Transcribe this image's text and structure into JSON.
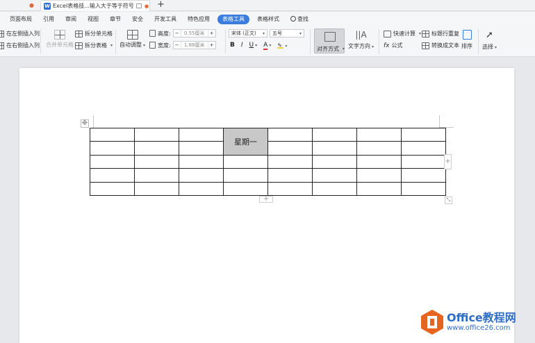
{
  "tabbar": {
    "doc_tab_title": "Excel表格技...输入大于等于符号",
    "doc_icon_letter": "W",
    "new_tab": "+"
  },
  "menu": {
    "items": [
      "页面布局",
      "引用",
      "审阅",
      "视图",
      "章节",
      "安全",
      "开发工具",
      "特色应用",
      "表格工具",
      "表格样式"
    ],
    "active_index": 8,
    "search_label": "查找"
  },
  "ribbon": {
    "insert_left": "在左侧插入列",
    "insert_right": "在右侧插入列",
    "merge_cells": "合并单元格",
    "split_cells": "拆分单元格",
    "split_table": "拆分表格",
    "auto_fit": "自动调整",
    "height_label": "高度:",
    "height_value": "0.55厘米",
    "width_label": "宽度:",
    "width_value": "1.88厘米",
    "font_name": "宋体 (正文)",
    "font_size": "五号",
    "bold": "B",
    "italic": "I",
    "underline": "U",
    "font_color": "A",
    "align": "对齐方式",
    "text_direction": "文字方向",
    "quick_calc": "快速计算",
    "formula": "公式",
    "formula_fx": "fx",
    "repeat_header": "标题行重复",
    "to_text": "转换成文本",
    "sort": "排序",
    "select": "选择"
  },
  "table": {
    "rows": 5,
    "cols": 8,
    "merged_cell_text": "星期一"
  },
  "watermark": {
    "brand": "Office教程网",
    "url": "www.office26.com"
  },
  "colors": {
    "accent": "#3b7ddd",
    "merged_cell": "#c8c8c8",
    "watermark_orange": "#e8641e",
    "watermark_blue": "#2f6dc4"
  }
}
